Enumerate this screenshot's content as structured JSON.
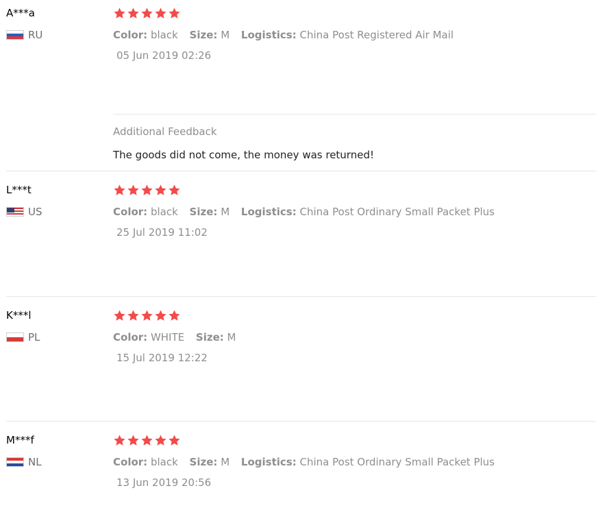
{
  "reviews": [
    {
      "username": "A***a",
      "country": "RU",
      "color_label": "Color:",
      "color": "black",
      "size_label": "Size:",
      "size": "M",
      "logistics_label": "Logistics:",
      "logistics": "China Post Registered Air Mail",
      "date": "05 Jun 2019 02:26",
      "rating": 5,
      "additional_feedback_title": "Additional Feedback",
      "additional_feedback_text": "The goods did not come, the money was returned!"
    },
    {
      "username": "L***t",
      "country": "US",
      "color_label": "Color:",
      "color": "black",
      "size_label": "Size:",
      "size": "M",
      "logistics_label": "Logistics:",
      "logistics": "China Post Ordinary Small Packet Plus",
      "date": "25 Jul 2019 11:02",
      "rating": 5
    },
    {
      "username": "K***l",
      "country": "PL",
      "color_label": "Color:",
      "color": "WHITE",
      "size_label": "Size:",
      "size": "M",
      "date": "15 Jul 2019 12:22",
      "rating": 5
    },
    {
      "username": "M***f",
      "country": "NL",
      "color_label": "Color:",
      "color": "black",
      "size_label": "Size:",
      "size": "M",
      "logistics_label": "Logistics:",
      "logistics": "China Post Ordinary Small Packet Plus",
      "date": "13 Jun 2019 20:56",
      "rating": 5
    }
  ],
  "colors": {
    "star": "#f24b4b",
    "muted_text": "#8e8e8e",
    "separator": "#e6e6e6"
  },
  "icons": {
    "star": "star-icon",
    "flag": "flag-icon"
  }
}
